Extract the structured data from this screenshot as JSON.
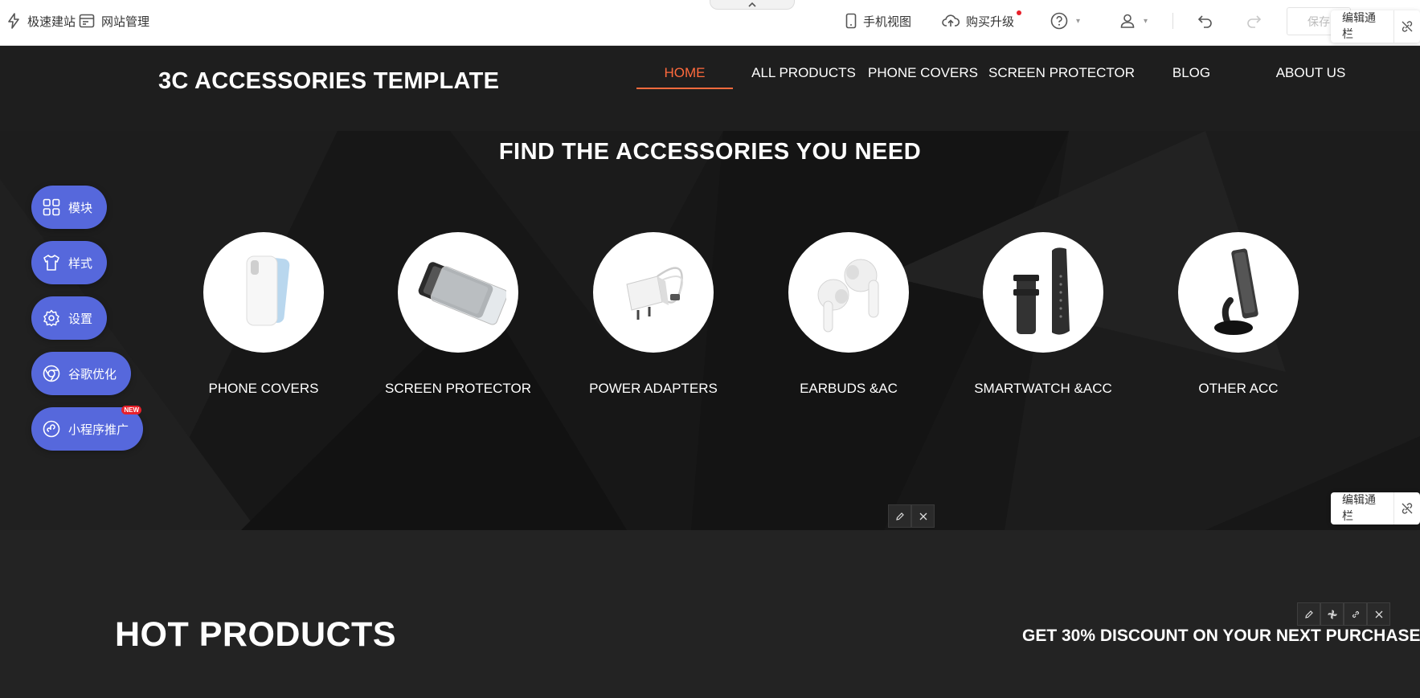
{
  "toolbar": {
    "quick_build": "极速建站",
    "site_manage": "网站管理",
    "mobile_view": "手机视图",
    "upgrade": "购买升级",
    "save": "保存",
    "edit_bar": "编辑通栏"
  },
  "site": {
    "logo": "3C ACCESSORIES TEMPLATE",
    "nav": [
      "HOME",
      "ALL PRODUCTS",
      "PHONE COVERS",
      "SCREEN PROTECTOR",
      "BLOG",
      "ABOUT US"
    ],
    "accent_color": "#ff6a3d"
  },
  "hero": {
    "title": "FIND THE ACCESSORIES YOU NEED",
    "categories": [
      {
        "label": "PHONE COVERS",
        "icon": "phone-cover-icon"
      },
      {
        "label": "SCREEN PROTECTOR",
        "icon": "screen-protector-icon"
      },
      {
        "label": "POWER ADAPTERS",
        "icon": "power-adapter-icon"
      },
      {
        "label": "EARBUDS &AC",
        "icon": "earbuds-icon"
      },
      {
        "label": "SMARTWATCH &ACC",
        "icon": "watch-strap-icon"
      },
      {
        "label": "OTHER ACC",
        "icon": "phone-holder-icon"
      }
    ]
  },
  "side_panel": {
    "items": [
      "模块",
      "样式",
      "设置",
      "谷歌优化",
      "小程序推广"
    ],
    "new_badge": "NEW",
    "color": "#5668dc"
  },
  "hot": {
    "title": "HOT PRODUCTS",
    "discount": "GET 30% DISCOUNT ON YOUR NEXT PURCHASE"
  }
}
